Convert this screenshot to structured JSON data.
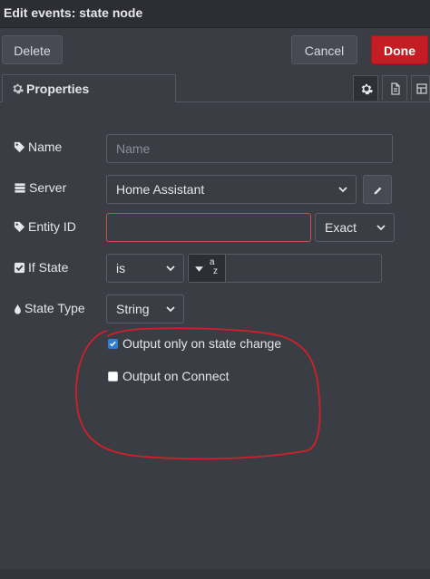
{
  "window": {
    "title": "Edit events: state node"
  },
  "toolbar": {
    "delete_label": "Delete",
    "cancel_label": "Cancel",
    "done_label": "Done"
  },
  "tabs": {
    "properties_label": "Properties",
    "icons": [
      "gear-icon",
      "description-icon",
      "appearance-icon"
    ]
  },
  "form": {
    "name": {
      "label": "Name",
      "placeholder": "Name",
      "value": ""
    },
    "server": {
      "label": "Server",
      "value": "Home Assistant"
    },
    "entity_id": {
      "label": "Entity ID",
      "value": "",
      "match": "Exact"
    },
    "if_state": {
      "label": "If State",
      "operator": "is",
      "type_glyph_top": "a",
      "type_glyph_bottom": "z",
      "value": ""
    },
    "state_type": {
      "label": "State Type",
      "value": "String"
    },
    "output_only_on_change": {
      "label": "Output only on state change",
      "checked": true
    },
    "output_on_connect": {
      "label": "Output on Connect",
      "checked": false
    }
  },
  "colors": {
    "done": "#c41e24",
    "annotation": "#d0202a",
    "checkbox": "#2d7fd6"
  }
}
